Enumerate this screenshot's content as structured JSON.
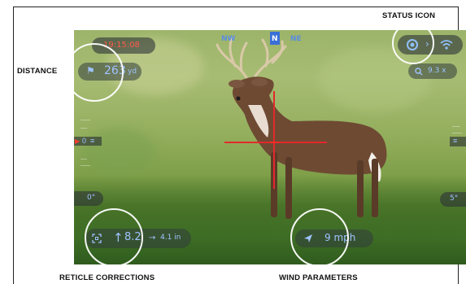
{
  "callouts": {
    "status_icon": "STATUS ICON",
    "distance": "DISTANCE",
    "reticle_corrections": "RETICLE CORRECTIONS",
    "wind_parameters": "WIND PARAMETERS"
  },
  "hud": {
    "clock": "19:15:08",
    "compass": {
      "left": "NW",
      "center": "N",
      "right": "NE"
    },
    "distance": {
      "value": "263",
      "unit": "yd"
    },
    "zoom": "9.3 x",
    "left_marker": "0",
    "left_angle": "0°",
    "right_angle": "5°",
    "elevation_correction": "8.2",
    "windage_correction": "4.1 in",
    "wind_speed": "9 mph"
  },
  "colors": {
    "reticle": "#e3282c",
    "hud_text": "#9fc3ff",
    "clock_text": "#ff5a4a"
  },
  "icons": {
    "status": "status-circle-icon",
    "wifi": "wifi-icon",
    "zoom": "magnifier-icon",
    "range": "range-flag-icon",
    "elevation": "arrow-up-icon",
    "windage": "arrow-right-icon",
    "wind": "wind-direction-icon",
    "reticle_correction": "crosshair-corners-icon"
  }
}
